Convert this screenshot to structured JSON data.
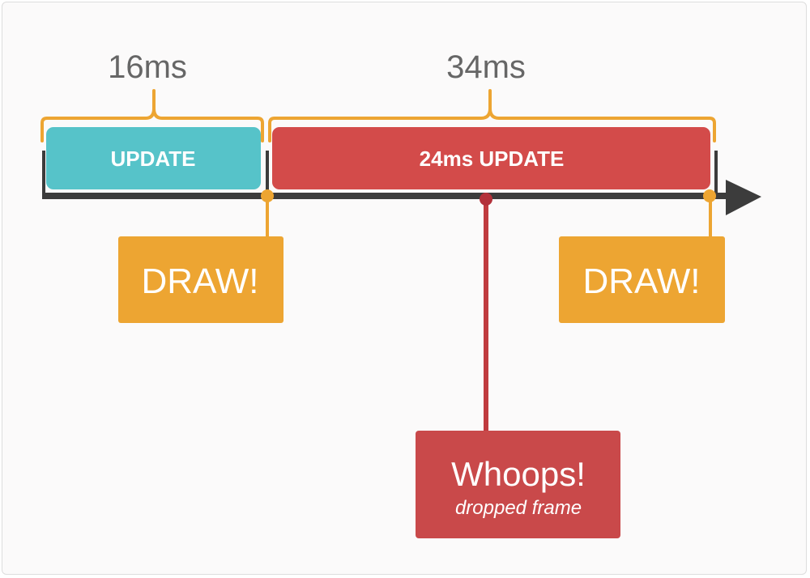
{
  "brackets": {
    "first_label": "16ms",
    "second_label": "34ms"
  },
  "bars": {
    "update_label": "UPDATE",
    "slow_update_label": "24ms UPDATE"
  },
  "draw_boxes": {
    "first_label": "DRAW!",
    "second_label": "DRAW!"
  },
  "whoops": {
    "title": "Whoops!",
    "subtitle": "dropped frame"
  },
  "colors": {
    "bracket": "#eda532",
    "update": "#56c3c9",
    "slow_update": "#d34b4a",
    "draw": "#eda532",
    "whoops": "#c9494a",
    "timeline": "#3c3c3c"
  }
}
